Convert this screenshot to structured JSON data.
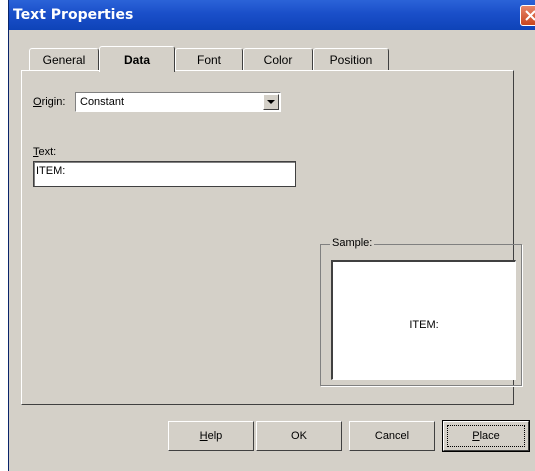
{
  "window": {
    "title": "Text Properties"
  },
  "tabs": [
    {
      "label": "General"
    },
    {
      "label": "Data",
      "active": true
    },
    {
      "label": "Font"
    },
    {
      "label": "Color"
    },
    {
      "label": "Position"
    }
  ],
  "form": {
    "origin_label_u": "O",
    "origin_label_rest": "rigin:",
    "origin_value": "Constant",
    "text_label_u": "T",
    "text_label_rest": "ext:",
    "text_value": "ITEM:"
  },
  "sample": {
    "label": "Sample:",
    "preview": "ITEM:"
  },
  "buttons": {
    "help_u": "H",
    "help_rest": "elp",
    "ok": "OK",
    "cancel": "Cancel",
    "place_u": "P",
    "place_rest": "lace"
  },
  "colors": {
    "titlebar": "#1a4fc9",
    "face": "#d4d0c8",
    "close": "#c8461e"
  }
}
